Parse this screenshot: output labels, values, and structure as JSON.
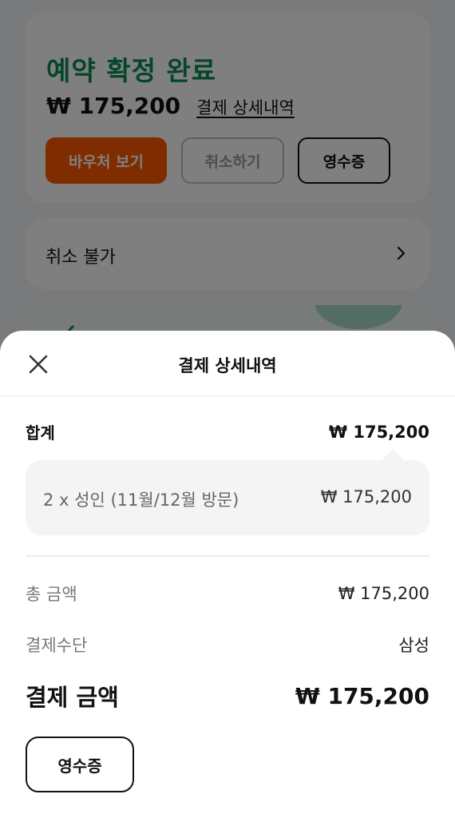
{
  "background": {
    "confirm_title": "예약 확정 완료",
    "price": "₩ 175,200",
    "detail_link": "결제 상세내역",
    "buttons": {
      "voucher": "바우처 보기",
      "cancel": "취소하기",
      "receipt": "영수증"
    },
    "cancel_policy": "취소 불가"
  },
  "sheet": {
    "title": "결제 상세내역",
    "total_label": "합계",
    "total_value": "₩ 175,200",
    "item": {
      "label": "2 x 성인 (11월/12월 방문)",
      "value": "₩ 175,200"
    },
    "sum_label": "총 금액",
    "sum_value": "₩ 175,200",
    "method_label": "결제수단",
    "method_value": "삼성",
    "paid_label": "결제 금액",
    "paid_value": "₩ 175,200",
    "receipt_button": "영수증"
  },
  "colors": {
    "accent_green": "#0a8a55",
    "accent_orange": "#ff5a00"
  },
  "icons": {
    "close": "close-icon",
    "chevron": "chevron-right-icon"
  }
}
